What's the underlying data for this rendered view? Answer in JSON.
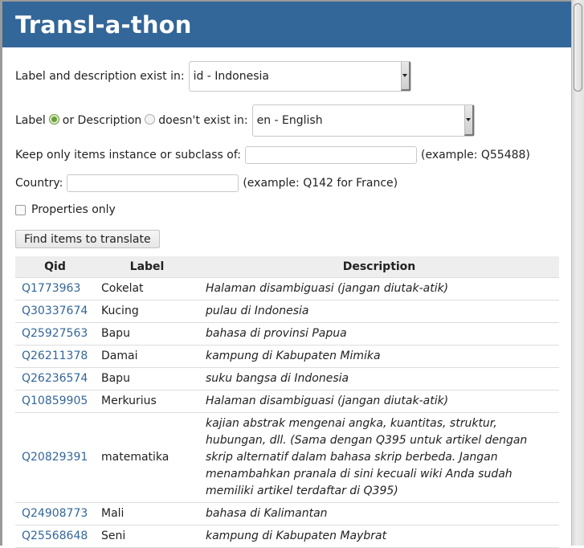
{
  "header": {
    "title": "Transl-a-thon"
  },
  "form": {
    "exist_label": "Label and description exist in:",
    "exist_select_value": "id - Indonesia",
    "missing_label_prefix": "Label",
    "missing_label_or": "or Description",
    "missing_label_suffix": "doesn't exist in:",
    "missing_radio_selected": "Label",
    "missing_select_value": "en - English",
    "instance_label": "Keep only items instance or subclass of:",
    "instance_value": "",
    "instance_hint": "(example: Q55488)",
    "country_label": "Country:",
    "country_value": "",
    "country_hint": "(example: Q142 for France)",
    "properties_only_label": "Properties only",
    "properties_only_checked": false,
    "submit_label": "Find items to translate"
  },
  "table": {
    "headers": {
      "qid": "Qid",
      "label": "Label",
      "description": "Description"
    },
    "rows": [
      {
        "qid": "Q1773963",
        "label": "Cokelat",
        "description": "Halaman disambiguasi (jangan diutak-atik)"
      },
      {
        "qid": "Q30337674",
        "label": "Kucing",
        "description": "pulau di Indonesia"
      },
      {
        "qid": "Q25927563",
        "label": "Bapu",
        "description": "bahasa di provinsi Papua"
      },
      {
        "qid": "Q26211378",
        "label": "Damai",
        "description": "kampung di Kabupaten Mimika"
      },
      {
        "qid": "Q26236574",
        "label": "Bapu",
        "description": "suku bangsa di Indonesia"
      },
      {
        "qid": "Q10859905",
        "label": "Merkurius",
        "description": "Halaman disambiguasi (jangan diutak-atik)"
      },
      {
        "qid": "Q20829391",
        "label": "matematika",
        "description": "kajian abstrak mengenai angka, kuantitas, struktur, hubungan, dll. (Sama dengan Q395 untuk artikel dengan skrip alternatif dalam bahasa skrip berbeda. Jangan menambahkan pranala di sini kecuali wiki Anda sudah memiliki artikel terdaftar di Q395)"
      },
      {
        "qid": "Q24908773",
        "label": "Mali",
        "description": "bahasa di Kalimantan"
      },
      {
        "qid": "Q25568648",
        "label": "Seni",
        "description": "kampung di Kabupaten Maybrat"
      }
    ]
  },
  "colors": {
    "header_bg": "#336699",
    "link": "#336699"
  }
}
